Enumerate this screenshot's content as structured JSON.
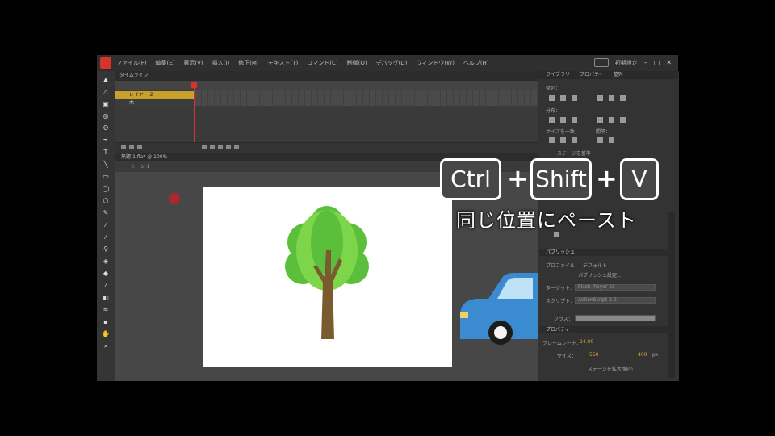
{
  "menubar": {
    "items": [
      "ファイル(F)",
      "編集(E)",
      "表示(V)",
      "挿入(I)",
      "修正(M)",
      "テキスト(T)",
      "コマンド(C)",
      "制御(O)",
      "デバッグ(D)",
      "ウィンドウ(W)",
      "ヘルプ(H)"
    ],
    "workspace_label": "初期設定",
    "window_buttons": [
      "–",
      "□",
      "✕"
    ]
  },
  "timeline": {
    "tab_label": "タイムライン",
    "layers": [
      "レイヤー 2",
      "木"
    ]
  },
  "document": {
    "tab_label": "無題-1.fla* @ 100%",
    "scene_label": "シーン 1"
  },
  "right_panel": {
    "tabs": [
      "ライブラリ",
      "プロパティ",
      "整列"
    ],
    "align_label": "整列：",
    "distribute_label": "分布：",
    "size_match_label": "サイズを一致：",
    "space_label": "間隔：",
    "stage_align_label": "ステージを基準",
    "publish_section": "パブリッシュ",
    "profile_label": "プロファイル：",
    "profile_value": "デフォルト",
    "publish_settings": "パブリッシュ設定...",
    "target_label": "ターゲット：",
    "target_value": "Flash Player 23",
    "script_label": "スクリプト：",
    "script_value": "ActionScript 3.0",
    "class_label": "クラス：",
    "properties_section": "プロパティ",
    "fps_label": "フレームレート：",
    "fps_value": "24.00",
    "size_label": "サイズ：",
    "width_value": "550",
    "height_value": "400",
    "px_label": "px",
    "advanced_settings": "ステージを拡大/縮小"
  },
  "overlay": {
    "key1": "Ctrl",
    "key2": "Shift",
    "key3": "V",
    "plus1": "+",
    "plus2": "+",
    "caption": "同じ位置にペースト"
  }
}
